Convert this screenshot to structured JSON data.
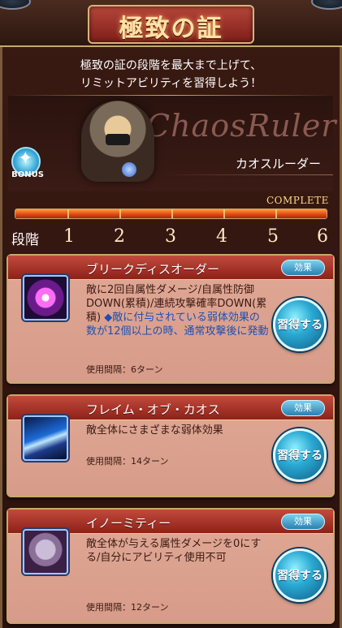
{
  "header": {
    "title": "極致の証"
  },
  "intro": {
    "line1": "極致の証の段階を最大まで上げて、",
    "line2": "リミットアビリティを習得しよう！"
  },
  "hero": {
    "script_name": "ChaosRuler",
    "name": "カオスルーダー",
    "bonus_label": "BONUS"
  },
  "progress": {
    "complete_label": "COMPLETE",
    "value_fraction": 1.0,
    "stage_label": "段階",
    "stages": [
      "1",
      "2",
      "3",
      "4",
      "5",
      "6"
    ]
  },
  "abilities": [
    {
      "name": "ブリークディスオーダー",
      "effect_label": "効果",
      "desc_plain": "敵に2回自属性ダメージ/自属性防御DOWN(累積)/連続攻撃確率DOWN(累積)",
      "desc_highlight": "◆敵に付与されている弱体効果の数が12個以上の時、通常攻撃後に発動",
      "cooldown": "使用間隔：6ターン",
      "learn_label": "習得する",
      "icon": "breach-icon"
    },
    {
      "name": "フレイム・オブ・カオス",
      "effect_label": "効果",
      "desc_plain": "敵全体にさまざまな弱体効果",
      "desc_highlight": "",
      "cooldown": "使用間隔：14ターン",
      "learn_label": "習得する",
      "icon": "flame-icon"
    },
    {
      "name": "イノーミティー",
      "effect_label": "効果",
      "desc_plain": "敵全体が与える属性ダメージを0にする/自分にアビリティ使用不可",
      "desc_highlight": "",
      "cooldown": "使用間隔：12ターン",
      "learn_label": "習得する",
      "icon": "skull-icon"
    }
  ]
}
